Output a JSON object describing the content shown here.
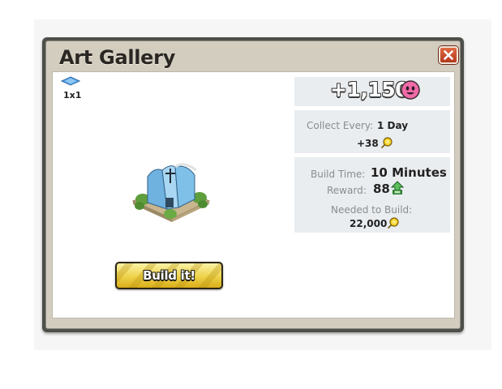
{
  "dialog": {
    "title": "Art Gallery",
    "close_icon": "close-x-icon",
    "size_label": "1x1",
    "size_icon": "tile-icon",
    "build_button_label": "Build it!"
  },
  "stats": {
    "income_value": "+1,150",
    "income_icon": "citizen-icon",
    "collect_label": "Collect Every:",
    "collect_value": "1 Day",
    "collect_coins": "+38",
    "coin_icon": "coin-icon",
    "build_time_label": "Build Time:",
    "build_time_value": "10 Minutes",
    "reward_label": "Reward:",
    "reward_value": "88",
    "reward_icon": "xp-icon",
    "needed_label": "Needed to Build:",
    "needed_value": "22,000"
  },
  "colors": {
    "frame": "#4d4f4a",
    "header": "#d2cdbf",
    "close_button": "#c8482a",
    "panel": "#e9edf0",
    "build_button": "#eed24a"
  }
}
